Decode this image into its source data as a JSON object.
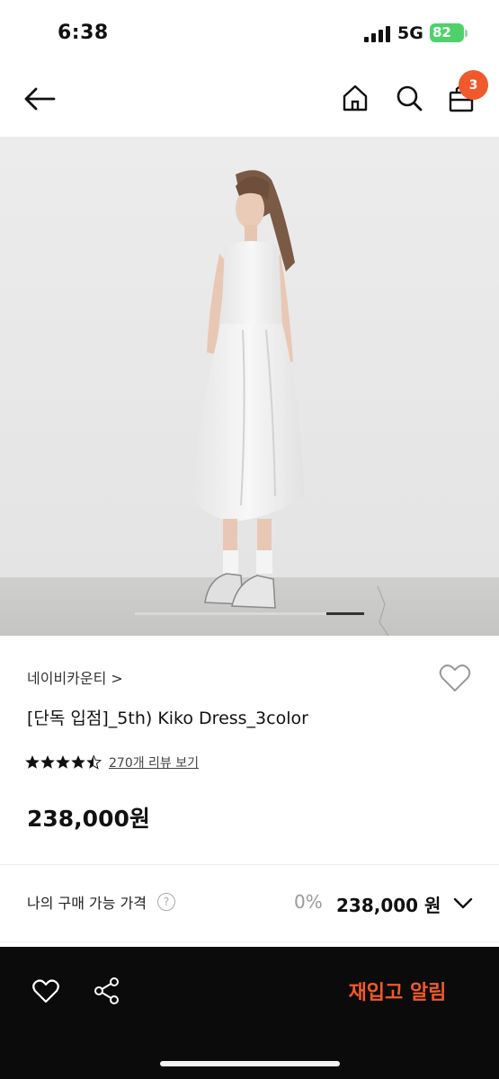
{
  "status_bar": {
    "time": "6:38",
    "network": "5G",
    "battery": "82"
  },
  "header": {
    "back_icon": "arrow-left-icon",
    "home_icon": "home-icon",
    "search_icon": "search-icon",
    "bag_icon": "shopping-bag-icon",
    "cart_count": "3"
  },
  "product": {
    "image_icon": "product-photo",
    "carousel_progress": 0.83,
    "brand": "네이비카운티 >",
    "name": "[단독 입점]_5th) Kiko Dress_3color",
    "rating_stars": "★★★★★",
    "rating": 4.5,
    "review_link": "270개 리뷰 보기",
    "price": "238,000원"
  },
  "purchase": {
    "label": "나의 구매 가능 가격",
    "help_icon": "?",
    "discount": "0%",
    "price": "238,000 원"
  },
  "bottom_bar": {
    "restock_label": "재입고 알림"
  },
  "colors": {
    "accent": "#f0592b",
    "bottom_bar": "#0b0b0b"
  }
}
